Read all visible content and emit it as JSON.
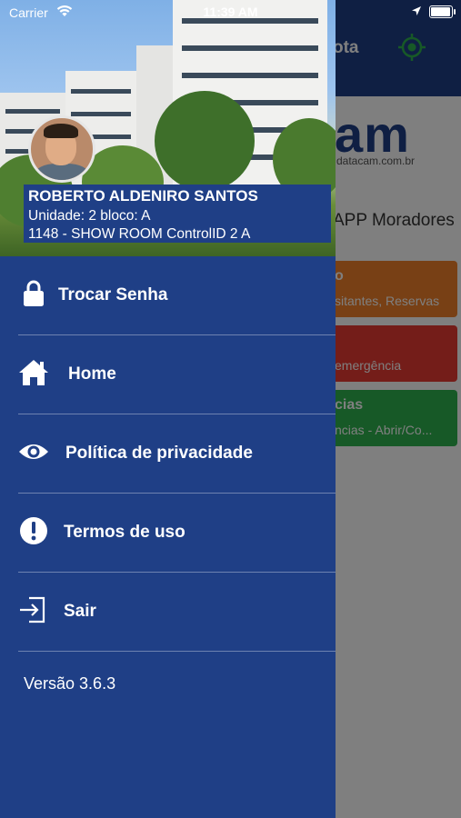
{
  "status_bar": {
    "carrier": "Carrier",
    "time": "11:39 AM"
  },
  "background_app": {
    "nav_title": "ota",
    "logo_text": "am",
    "logo_url": "datacam.com.br",
    "subtitle": "APP Moradores",
    "cards": [
      {
        "title": "o",
        "subtitle": "sitantes, Reservas",
        "color": "#f0812a"
      },
      {
        "title": "",
        "subtitle": "emergência",
        "color": "#e83a33"
      },
      {
        "title": "cias",
        "subtitle": "ncias - Abrir/Co...",
        "color": "#2fb24f"
      }
    ]
  },
  "drawer": {
    "user": {
      "name": "ROBERTO ALDENIRO SANTOS",
      "unit": "Unidade: 2 bloco: A",
      "condo": "1148 - SHOW ROOM ControlID 2 A"
    },
    "menu": [
      {
        "label": "Trocar Senha",
        "icon": "lock-icon"
      },
      {
        "label": "Home",
        "icon": "home-icon"
      },
      {
        "label": "Política de privacidade",
        "icon": "eye-icon"
      },
      {
        "label": "Termos de uso",
        "icon": "exclamation-circle-icon"
      },
      {
        "label": "Sair",
        "icon": "logout-icon"
      }
    ],
    "version": "Versão 3.6.3"
  },
  "colors": {
    "primary": "#1f3f86",
    "orange": "#f0812a",
    "red": "#e83a33",
    "green": "#2fb24f"
  }
}
